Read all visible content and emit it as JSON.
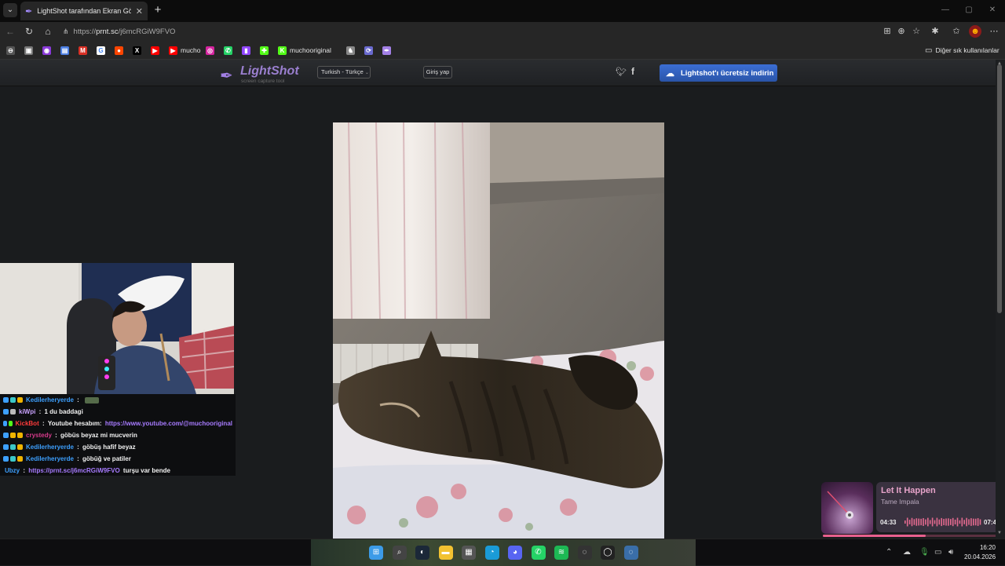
{
  "browser": {
    "tab_title": "LightShot tarafından Ekran Görüntüsü",
    "url_prefix": "https://",
    "url_host": "prnt.sc",
    "url_path": "/j6mcRGiW9FVO",
    "bookmarks": [
      {
        "label": "",
        "icon": "link-icon",
        "color": "#555555"
      },
      {
        "label": "",
        "icon": "photo-icon",
        "color": "#777777"
      },
      {
        "label": "",
        "icon": "circle-app-icon",
        "color": "#8a3ad8"
      },
      {
        "label": "",
        "icon": "docs-icon",
        "color": "#4a7de0"
      },
      {
        "label": "",
        "icon": "gmail-icon",
        "color": "#d93025"
      },
      {
        "label": "",
        "icon": "google-icon",
        "color": "#ffffff"
      },
      {
        "label": "",
        "icon": "reddit-icon",
        "color": "#ff4500"
      },
      {
        "label": "",
        "icon": "x-icon",
        "color": "#000000"
      },
      {
        "label": "",
        "icon": "youtube-icon",
        "color": "#ff0000"
      },
      {
        "label": "mucho",
        "icon": "youtube-icon",
        "color": "#ff0000"
      },
      {
        "label": "",
        "icon": "instagram-icon",
        "color": "#d6249f"
      },
      {
        "label": "",
        "icon": "whatsapp-icon",
        "color": "#25d366"
      },
      {
        "label": "",
        "icon": "twitch-icon",
        "color": "#9146ff"
      },
      {
        "label": "",
        "icon": "puzzle-icon",
        "color": "#53fc18"
      },
      {
        "label": "muchooriginal",
        "icon": "kick-icon",
        "color": "#53fc18"
      },
      {
        "label": "",
        "icon": "chess-icon",
        "color": "#888888"
      },
      {
        "label": "",
        "icon": "sync-icon",
        "color": "#6a6acf"
      },
      {
        "label": "",
        "icon": "feather-icon",
        "color": "#a380e6"
      }
    ],
    "other_bookmarks": "Diğer sık kullanılanlar"
  },
  "lightshot": {
    "logo_name": "LightShot",
    "logo_tagline": "screen capture tool",
    "language": "Turkish - Türkçe",
    "login": "Giriş yap",
    "download": "Lightshot'ı ücretsiz indirin"
  },
  "chat": [
    {
      "user": "Kedilerheryerde",
      "style": "user-kedi",
      "sep": " : ",
      "text": "",
      "link": "",
      "tail": "",
      "badges": [
        "#3da0ff",
        "#3cc8c8",
        "#f0b400"
      ],
      "emote": true
    },
    {
      "user": "kiWpi",
      "style": "user-kiwi",
      "sep": " : ",
      "text": "1 du baddagi",
      "link": "",
      "tail": "",
      "badges": [
        "#3da0ff",
        "#bbbbbb"
      ],
      "emote": false
    },
    {
      "user": "KickBot",
      "style": "user-kick",
      "sep": " : ",
      "text": "Youtube hesabım: ",
      "link": "https://www.youtube.com/@muchooriginal",
      "tail": "",
      "badges": [
        "#3da0ff",
        "#53fc18"
      ],
      "emote": false
    },
    {
      "user": "crystedy",
      "style": "user-crys",
      "sep": " : ",
      "text": "göbüs beyaz mi mucverin",
      "link": "",
      "tail": "",
      "badges": [
        "#3da0ff",
        "#f0b400",
        "#f0b400"
      ],
      "emote": false
    },
    {
      "user": "Kedilerheryerde",
      "style": "user-kedi",
      "sep": " : ",
      "text": "göbüş hafif beyaz",
      "link": "",
      "tail": "",
      "badges": [
        "#3da0ff",
        "#3cc8c8",
        "#f0b400"
      ],
      "emote": false
    },
    {
      "user": "Kedilerheryerde",
      "style": "user-kedi",
      "sep": " : ",
      "text": "göbüğ ve patiler",
      "link": "",
      "tail": "",
      "badges": [
        "#3da0ff",
        "#3cc8c8",
        "#f0b400"
      ],
      "emote": false
    },
    {
      "user": "Ubzy",
      "style": "user-ubzy",
      "sep": " : ",
      "text": "",
      "link": "https://prnt.sc/j6mcRGiW9FVO",
      "tail": " turşu var bende",
      "badges": [],
      "emote": false
    }
  ],
  "spotify": {
    "title": "Let It Happen",
    "artist": "Tame Impala",
    "elapsed": "04:33",
    "total": "07:47",
    "progress": 0.585
  },
  "scroll": {
    "position": 0.0,
    "visible_fraction": 0.53
  },
  "taskbar": {
    "apps": [
      {
        "icon": "windows-start-icon",
        "color": "#3c9be8"
      },
      {
        "icon": "search-icon",
        "color": "#444444"
      },
      {
        "icon": "steam-icon",
        "color": "#1b2838"
      },
      {
        "icon": "file-explorer-icon",
        "color": "#f2c231"
      },
      {
        "icon": "store-icon",
        "color": "#555555"
      },
      {
        "icon": "edge-icon",
        "color": "#1a9bd7"
      },
      {
        "icon": "discord-icon",
        "color": "#5865f2"
      },
      {
        "icon": "whatsapp-icon",
        "color": "#25d366"
      },
      {
        "icon": "spotify-icon",
        "color": "#1db954"
      },
      {
        "icon": "app-icon",
        "color": "#333333"
      },
      {
        "icon": "obs-icon",
        "color": "#222222"
      },
      {
        "icon": "app-icon",
        "color": "#3a6ea8"
      }
    ],
    "time": "16:20",
    "date": "20.04.2026"
  }
}
